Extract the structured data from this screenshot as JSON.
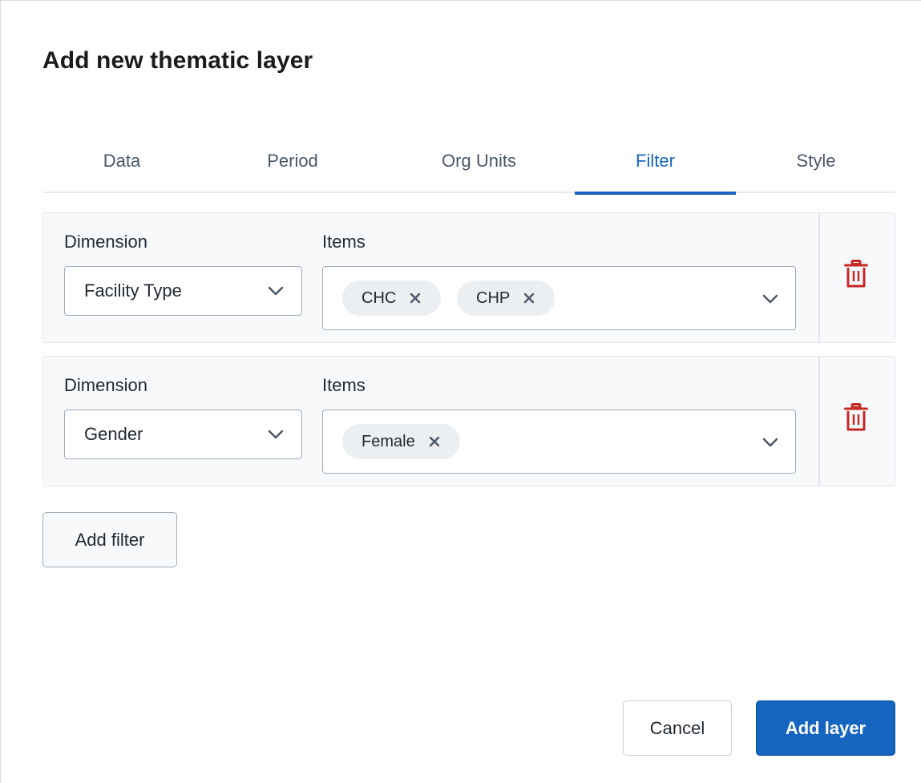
{
  "dialog": {
    "title": "Add new thematic layer"
  },
  "tabs": [
    {
      "label": "Data",
      "active": false
    },
    {
      "label": "Period",
      "active": false
    },
    {
      "label": "Org Units",
      "active": false
    },
    {
      "label": "Filter",
      "active": true
    },
    {
      "label": "Style",
      "active": false
    }
  ],
  "filters": [
    {
      "dimension_label": "Dimension",
      "items_label": "Items",
      "dimension_value": "Facility Type",
      "items": [
        {
          "label": "CHC"
        },
        {
          "label": "CHP"
        }
      ],
      "delete_icon": "trash-icon"
    },
    {
      "dimension_label": "Dimension",
      "items_label": "Items",
      "dimension_value": "Gender",
      "items": [
        {
          "label": "Female"
        }
      ],
      "delete_icon": "trash-icon"
    }
  ],
  "actions": {
    "add_filter_label": "Add filter",
    "cancel_label": "Cancel",
    "add_layer_label": "Add layer"
  },
  "colors": {
    "accent": "#1565c0",
    "danger": "#c62828",
    "panel_bg": "#f8f9fa",
    "chip_bg": "#eceff1"
  }
}
